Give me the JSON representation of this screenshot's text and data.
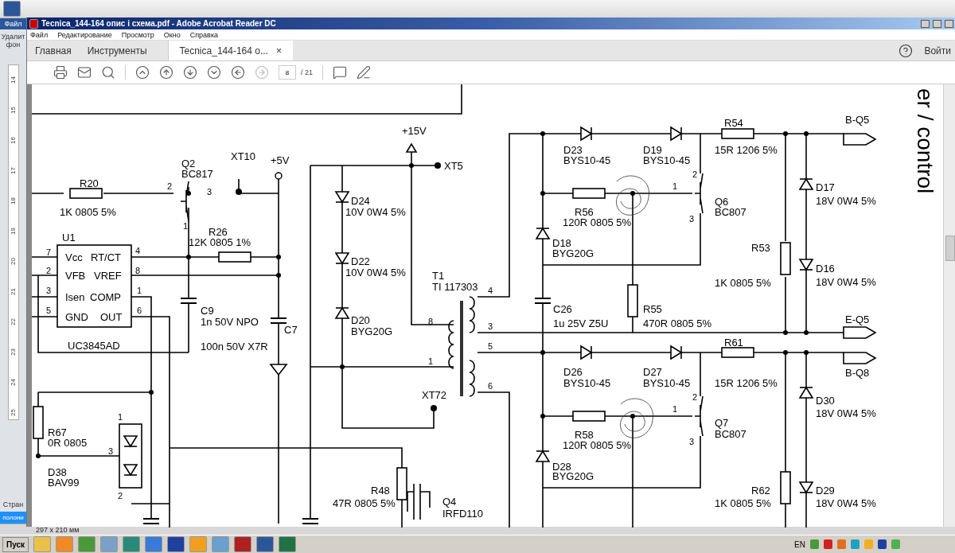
{
  "word": {
    "file_tab": "Файл",
    "remove_bg": "Удалит фон",
    "ruler": [
      "14",
      "15",
      "16",
      "17",
      "18",
      "19",
      "20",
      "21",
      "22",
      "23",
      "24",
      "25"
    ],
    "pages_label": "Стран",
    "lang_label": "полони",
    "page_size": "297 x 210 мм"
  },
  "window": {
    "title": "Tecnica_144-164 опис і схема.pdf - Adobe Acrobat Reader DC"
  },
  "menu": [
    "Файл",
    "Редактирование",
    "Просмотр",
    "Окно",
    "Справка"
  ],
  "tabs": [
    {
      "label": "Главная",
      "selected": false
    },
    {
      "label": "Инструменты",
      "selected": false
    },
    {
      "label": "Tecnica_144-164 о...",
      "selected": true,
      "close": "×"
    }
  ],
  "sign_in": "Войти",
  "page_nav": {
    "page": "8",
    "total": "/ 21"
  },
  "schematic": {
    "side_title": "er / control",
    "labels": [
      "+15V",
      "Q2",
      "BC817",
      "XT10",
      "+5V",
      "XT5",
      "R20",
      "1K 0805 5%",
      "2",
      "3",
      "1",
      "D24",
      "10V 0W4 5%",
      "R26",
      "12K 0805 1%",
      "U1",
      "Vcc",
      "RT/CT",
      "VFB",
      "VREF",
      "Isen",
      "COMP",
      "GND",
      "OUT",
      "7",
      "2",
      "3",
      "5",
      "4",
      "8",
      "1",
      "6",
      "UC3845AD",
      "D22",
      "10V 0W4 5%",
      "T1",
      "TI 117303",
      "C9",
      "1n 50V NPO",
      "C7",
      "100n 50V X7R",
      "D20",
      "BYG20G",
      "8",
      "1",
      "4",
      "3",
      "5",
      "6",
      "D23",
      "BYS10-45",
      "D19",
      "BYS10-45",
      "R54",
      "15R 1206 5%",
      "B-Q5",
      "R56",
      "120R 0805 5%",
      "1",
      "2",
      "3",
      "Q6",
      "BC807",
      "D17",
      "18V 0W4 5%",
      "D18",
      "BYG20G",
      "R53",
      "1K 0805 5%",
      "D16",
      "18V 0W4 5%",
      "C26",
      "1u 25V Z5U",
      "R55",
      "470R 0805 5%",
      "E-Q5",
      "D26",
      "BYS10-45",
      "D27",
      "BYS10-45",
      "R61",
      "15R 1206 5%",
      "B-Q8",
      "XT72",
      "D30",
      "18V 0W4 5%",
      "R67",
      "0R 0805",
      "R58",
      "120R 0805 5%",
      "1",
      "2",
      "3",
      "Q7",
      "BC807",
      "D38",
      "BAV99",
      "1",
      "3",
      "2",
      "D28",
      "BYG20G",
      "R48",
      "47R 0805 5%",
      "Q4",
      "IRFD110",
      "R62",
      "1K 0805 5%",
      "D29",
      "18V 0W4 5%"
    ]
  },
  "taskbar": {
    "start": "Пуск",
    "lang": "EN"
  }
}
